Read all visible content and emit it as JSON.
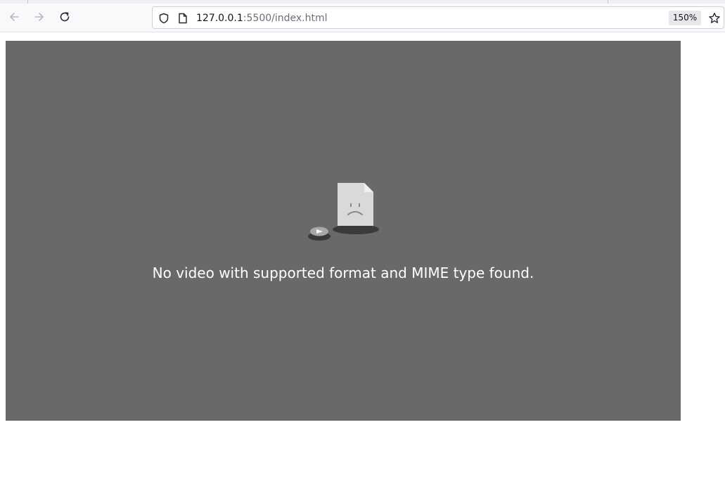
{
  "browser": {
    "nav": {
      "back_icon": "arrow-left-icon",
      "forward_icon": "arrow-right-icon",
      "reload_icon": "reload-icon"
    },
    "urlbar": {
      "host": "127.0.0.1",
      "rest": ":5500/index.html",
      "zoom": "150%",
      "security_icon": "shield-icon",
      "page_icon": "page-icon",
      "bookmark_icon": "star-icon"
    }
  },
  "video": {
    "background": "#696969",
    "error_message": "No video with supported format and MIME type found.",
    "error_icon": "sad-file-icon"
  }
}
